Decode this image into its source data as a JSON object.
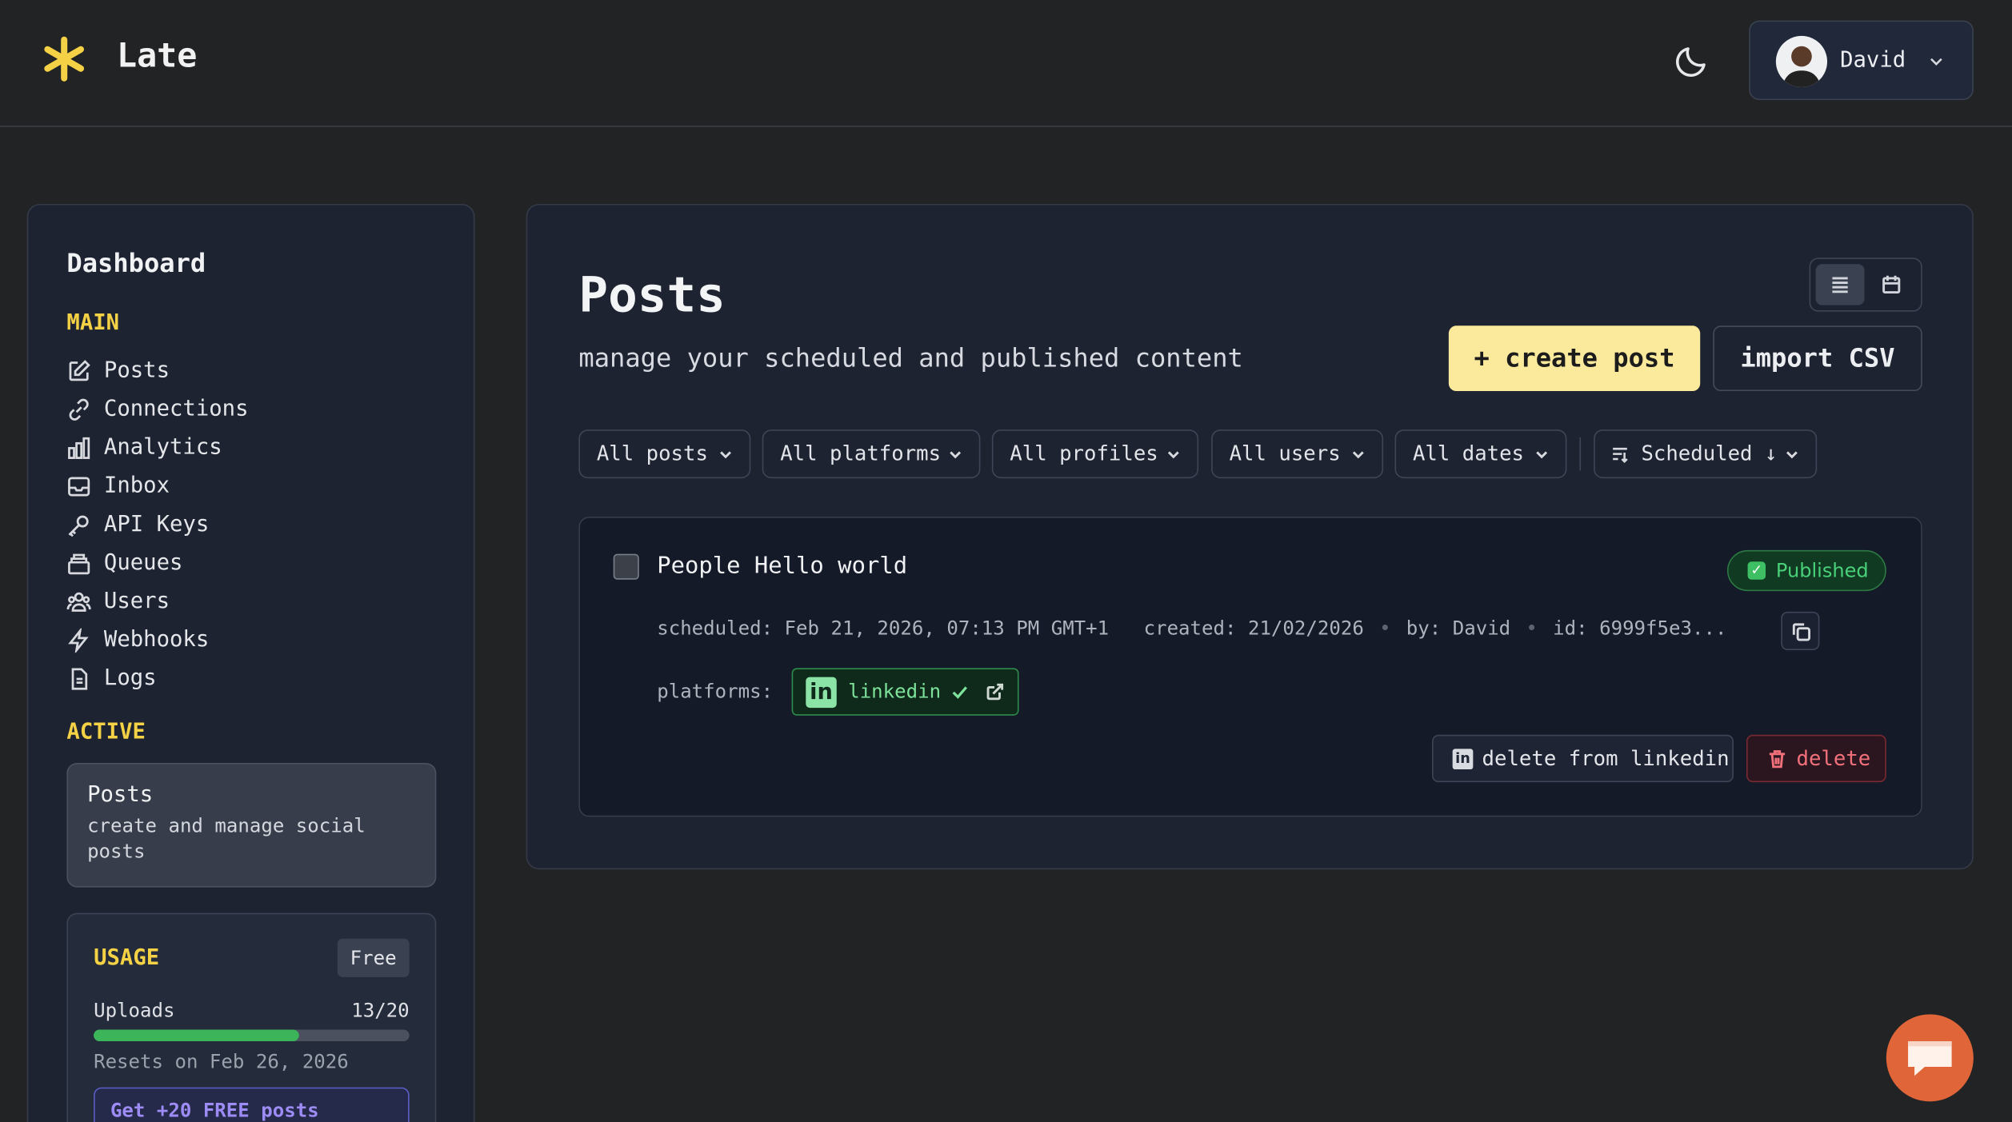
{
  "header": {
    "brand": "Late",
    "user_name": "David"
  },
  "sidebar": {
    "title": "Dashboard",
    "main_label": "MAIN",
    "items": [
      {
        "label": "Posts",
        "icon": "edit-icon"
      },
      {
        "label": "Connections",
        "icon": "link-icon"
      },
      {
        "label": "Analytics",
        "icon": "bar-chart-icon"
      },
      {
        "label": "Inbox",
        "icon": "inbox-icon"
      },
      {
        "label": "API Keys",
        "icon": "key-icon"
      },
      {
        "label": "Queues",
        "icon": "layers-icon"
      },
      {
        "label": "Users",
        "icon": "users-icon"
      },
      {
        "label": "Webhooks",
        "icon": "zap-icon"
      },
      {
        "label": "Logs",
        "icon": "file-icon"
      }
    ],
    "active_label": "ACTIVE",
    "active_card": {
      "title": "Posts",
      "description": "create and manage social posts"
    },
    "usage": {
      "title": "USAGE",
      "plan": "Free",
      "uploads_label": "Uploads",
      "uploads_count": "13/20",
      "uploads_fraction": 0.65,
      "resets": "Resets on Feb 26, 2026",
      "promo": "Get +20 FREE posts"
    }
  },
  "main": {
    "title": "Posts",
    "subtitle": "manage your scheduled and published content",
    "create_label": "+ create post",
    "import_label": "import CSV",
    "filters": [
      "All posts",
      "All platforms",
      "All profiles",
      "All users",
      "All dates"
    ],
    "sort_label": "Scheduled ↓"
  },
  "post": {
    "title": "People Hello world",
    "status": "Published",
    "scheduled": "scheduled: Feb 21, 2026, 07:13 PM GMT+1",
    "created": "created: 21/02/2026",
    "by": "by: David",
    "id": "id: 6999f5e3...",
    "platforms_label": "platforms:",
    "platform": "linkedin",
    "delete_from_label": "delete from linkedin",
    "delete_label": "delete"
  },
  "colors": {
    "accent": "#f5d245",
    "create_button": "#fbe99c",
    "published": "#49d17a",
    "danger": "#f1707a",
    "chat": "#e0663a"
  }
}
